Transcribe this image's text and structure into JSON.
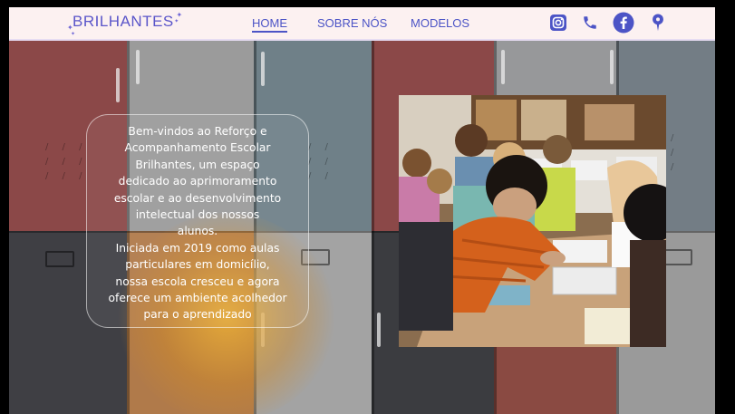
{
  "header": {
    "logo": "BRILHANTES",
    "nav": [
      {
        "label": "HOME",
        "active": true
      },
      {
        "label": "SOBRE NÓS",
        "active": false
      },
      {
        "label": "MODELOS",
        "active": false
      }
    ],
    "social_icons": [
      "instagram-icon",
      "phone-icon",
      "facebook-icon",
      "location-pin-icon"
    ]
  },
  "intro": {
    "lines": [
      "Bem-vindos ao Reforço e",
      "Acompanhamento Escolar",
      "Brilhantes, um espaço",
      "dedicado ao aprimoramento",
      "escolar e ao desenvolvimento",
      "intelectual dos nossos",
      "alunos.",
      "Iniciada em 2019 como aulas",
      "particulares em domicílio,",
      "nossa escola cresceu e agora",
      "oferece um ambiente acolhedor",
      "para o aprendizado"
    ]
  },
  "colors": {
    "brand": "#4c54c6",
    "header_bg": "#fcf1f1",
    "text_on_photo": "#ffffff"
  }
}
